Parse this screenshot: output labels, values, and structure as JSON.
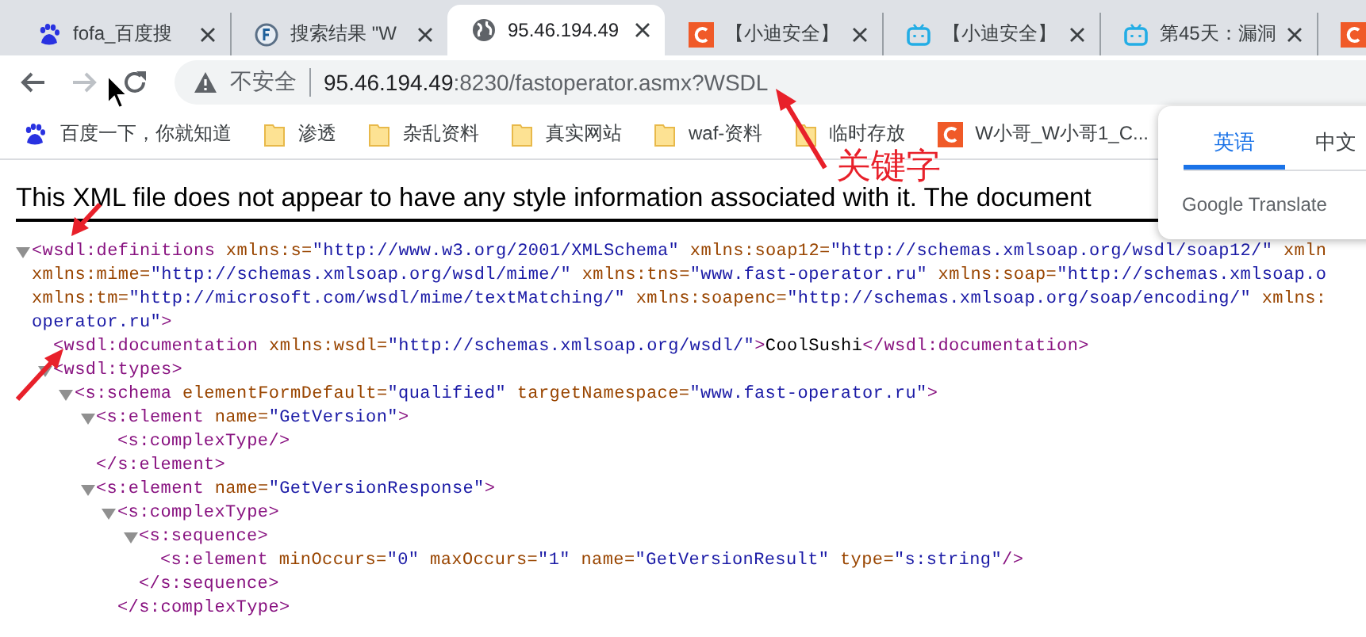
{
  "tabs": [
    {
      "kind": "paw",
      "title": "fofa_百度搜",
      "selected": false
    },
    {
      "kind": "circle",
      "title": "搜索结果 \"W",
      "selected": false
    },
    {
      "kind": "globe",
      "title": "95.46.194.49",
      "selected": true
    },
    {
      "kind": "tile",
      "title": "【小迪安全】",
      "selected": false
    },
    {
      "kind": "tv",
      "title": "【小迪安全】",
      "selected": false
    },
    {
      "kind": "tv",
      "title": "第45天：漏洞",
      "selected": false
    },
    {
      "kind": "tile",
      "selected": false
    }
  ],
  "nav": [
    {
      "kind": "back",
      "disabled": false
    },
    {
      "kind": "forward",
      "disabled": true
    },
    {
      "kind": "reload",
      "disabled": false
    }
  ],
  "omnibox": {
    "security": "不安全",
    "host": "95.46.194.49",
    "path": ":8230/fastoperator.asmx?WSDL"
  },
  "bookmarks": [
    {
      "kind": "paw",
      "label": "百度一下，你就知道"
    },
    {
      "kind": "folder",
      "label": "渗透"
    },
    {
      "kind": "folder",
      "label": "杂乱资料"
    },
    {
      "kind": "folder",
      "label": "真实网站"
    },
    {
      "kind": "folder",
      "label": "waf-资料"
    },
    {
      "kind": "folder",
      "label": "临时存放"
    },
    {
      "kind": "tile",
      "label": "W小哥_W小哥1_C..."
    }
  ],
  "notice": "This XML file does not appear to have any style information associated with it. The document",
  "xml": [
    {
      "expanded": true,
      "open": [
        [
          {
            "kind": "tag",
            "text": "<wsdl:definitions"
          },
          {
            "kind": "attr",
            "text": " xmlns:s="
          },
          {
            "kind": "value",
            "text": "\"http://www.w3.org/2001/XMLSchema\""
          },
          {
            "kind": "attr",
            "text": " xmlns:soap12="
          },
          {
            "kind": "value",
            "text": "\"http://schemas.xmlsoap.org/wsdl/soap12/\""
          },
          {
            "kind": "attr",
            "text": " xmln"
          }
        ],
        [
          {
            "kind": "attr",
            "text": "xmlns:mime="
          },
          {
            "kind": "value",
            "text": "\"http://schemas.xmlsoap.org/wsdl/mime/\""
          },
          {
            "kind": "attr",
            "text": " xmlns:tns="
          },
          {
            "kind": "value",
            "text": "\"www.fast-operator.ru\""
          },
          {
            "kind": "attr",
            "text": " xmlns:soap="
          },
          {
            "kind": "value",
            "text": "\"http://schemas.xmlsoap.o"
          }
        ],
        [
          {
            "kind": "attr",
            "text": "xmlns:tm="
          },
          {
            "kind": "value",
            "text": "\"http://microsoft.com/wsdl/mime/textMatching/\""
          },
          {
            "kind": "attr",
            "text": " xmlns:soapenc="
          },
          {
            "kind": "value",
            "text": "\"http://schemas.xmlsoap.org/soap/encoding/\""
          },
          {
            "kind": "attr",
            "text": " xmlns:"
          }
        ],
        [
          {
            "kind": "value",
            "text": "operator.ru\""
          },
          {
            "kind": "tag",
            "text": ">"
          }
        ]
      ],
      "children": [
        {
          "open": [
            [
              {
                "kind": "tag",
                "text": "<wsdl:documentation"
              },
              {
                "kind": "attr",
                "text": " xmlns:wsdl="
              },
              {
                "kind": "value",
                "text": "\"http://schemas.xmlsoap.org/wsdl/\""
              },
              {
                "kind": "tag",
                "text": ">"
              },
              {
                "kind": "text",
                "text": "CoolSushi"
              },
              {
                "kind": "tag",
                "text": "</wsdl:documentation>"
              }
            ]
          ]
        },
        {
          "expanded": true,
          "open": [
            [
              {
                "kind": "tag",
                "text": "<wsdl:types>"
              }
            ]
          ],
          "children": [
            {
              "expanded": true,
              "open": [
                [
                  {
                    "kind": "tag",
                    "text": "<s:schema"
                  },
                  {
                    "kind": "attr",
                    "text": " elementFormDefault="
                  },
                  {
                    "kind": "value",
                    "text": "\"qualified\""
                  },
                  {
                    "kind": "attr",
                    "text": " targetNamespace="
                  },
                  {
                    "kind": "value",
                    "text": "\"www.fast-operator.ru\""
                  },
                  {
                    "kind": "tag",
                    "text": ">"
                  }
                ]
              ],
              "children": [
                {
                  "expanded": true,
                  "open": [
                    [
                      {
                        "kind": "tag",
                        "text": "<s:element"
                      },
                      {
                        "kind": "attr",
                        "text": " name="
                      },
                      {
                        "kind": "value",
                        "text": "\"GetVersion\""
                      },
                      {
                        "kind": "tag",
                        "text": ">"
                      }
                    ]
                  ],
                  "children": [
                    {
                      "open": [
                        [
                          {
                            "kind": "tag",
                            "text": "<s:complexType/>"
                          }
                        ]
                      ]
                    }
                  ],
                  "close": [
                    {
                      "kind": "tag",
                      "text": "</s:element>"
                    }
                  ]
                },
                {
                  "expanded": true,
                  "open": [
                    [
                      {
                        "kind": "tag",
                        "text": "<s:element"
                      },
                      {
                        "kind": "attr",
                        "text": " name="
                      },
                      {
                        "kind": "value",
                        "text": "\"GetVersionResponse\""
                      },
                      {
                        "kind": "tag",
                        "text": ">"
                      }
                    ]
                  ],
                  "children": [
                    {
                      "expanded": true,
                      "open": [
                        [
                          {
                            "kind": "tag",
                            "text": "<s:complexType>"
                          }
                        ]
                      ],
                      "children": [
                        {
                          "expanded": true,
                          "open": [
                            [
                              {
                                "kind": "tag",
                                "text": "<s:sequence>"
                              }
                            ]
                          ],
                          "children": [
                            {
                              "open": [
                                [
                                  {
                                    "kind": "tag",
                                    "text": "<s:element"
                                  },
                                  {
                                    "kind": "attr",
                                    "text": " minOccurs="
                                  },
                                  {
                                    "kind": "value",
                                    "text": "\"0\""
                                  },
                                  {
                                    "kind": "attr",
                                    "text": " maxOccurs="
                                  },
                                  {
                                    "kind": "value",
                                    "text": "\"1\""
                                  },
                                  {
                                    "kind": "attr",
                                    "text": " name="
                                  },
                                  {
                                    "kind": "value",
                                    "text": "\"GetVersionResult\""
                                  },
                                  {
                                    "kind": "attr",
                                    "text": " type="
                                  },
                                  {
                                    "kind": "value",
                                    "text": "\"s:string\""
                                  },
                                  {
                                    "kind": "tag",
                                    "text": "/>"
                                  }
                                ]
                              ]
                            }
                          ],
                          "close": [
                            {
                              "kind": "tag",
                              "text": "</s:sequence>"
                            }
                          ]
                        }
                      ],
                      "close": [
                        {
                          "kind": "tag",
                          "text": "</s:complexType>"
                        }
                      ]
                    }
                  ]
                }
              ]
            }
          ]
        }
      ]
    }
  ],
  "translate": {
    "languages": [
      {
        "label": "英语",
        "selected": true
      },
      {
        "label": "中文",
        "selected": false
      }
    ],
    "footer": "Google Translate"
  },
  "annotation": {
    "label": "关键字"
  }
}
